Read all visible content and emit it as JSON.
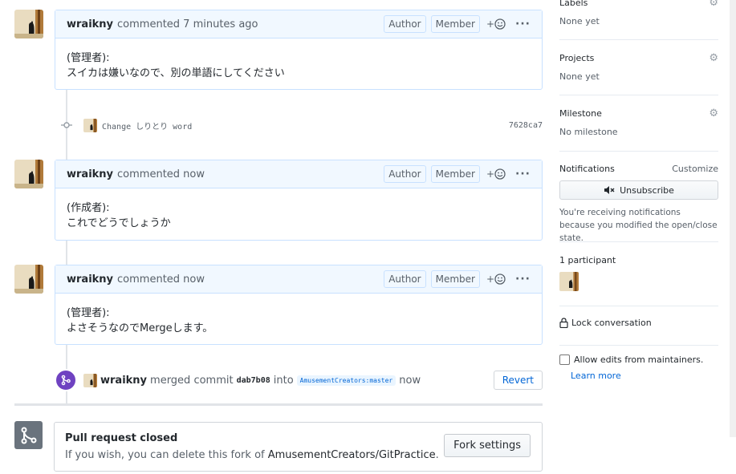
{
  "comments": [
    {
      "author": "wraikny",
      "meta": "commented 7 minutes ago",
      "badges": [
        "Author",
        "Member"
      ],
      "body_line1": "(管理者):",
      "body_line2": "スイカは嫌いなので、別の単語にしてください"
    },
    {
      "author": "wraikny",
      "meta": "commented now",
      "badges": [
        "Author",
        "Member"
      ],
      "body_line1": "(作成者):",
      "body_line2": "これでどうでしょうか"
    },
    {
      "author": "wraikny",
      "meta": "commented now",
      "badges": [
        "Author",
        "Member"
      ],
      "body_line1": "(管理者):",
      "body_line2": "よさそうなのでMergeします。"
    }
  ],
  "commit": {
    "message": "Change しりとり word",
    "sha": "7628ca7"
  },
  "merge_event": {
    "author": "wraikny",
    "action": "merged commit",
    "sha": "dab7b08",
    "into": "into",
    "branch": "AmusementCreators:master",
    "time": "now",
    "revert_label": "Revert"
  },
  "closed": {
    "title": "Pull request closed",
    "sub_prefix": "If you wish, you can delete this fork of",
    "repo": "AmusementCreators/GitPractice",
    "sub_suffix": ".",
    "fork_settings_label": "Fork settings"
  },
  "sidebar": {
    "labels": {
      "heading": "Labels",
      "value": "None yet"
    },
    "projects": {
      "heading": "Projects",
      "value": "None yet"
    },
    "milestone": {
      "heading": "Milestone",
      "value": "No milestone"
    },
    "notifications": {
      "heading": "Notifications",
      "customize": "Customize",
      "unsubscribe_label": "Unsubscribe",
      "note": "You're receiving notifications because you modified the open/close state."
    },
    "participants": {
      "heading": "1 participant"
    },
    "lock_label": "Lock conversation",
    "allow_edits_label": "Allow edits from maintainers.",
    "learn_more": "Learn more"
  },
  "reaction_symbol": "+",
  "kebab_symbol": "···",
  "colors": {
    "merge_purple": "#6f42c1",
    "comment_border": "#c8e1ff",
    "header_bg": "#f1f8ff",
    "link_blue": "#0366d6"
  }
}
